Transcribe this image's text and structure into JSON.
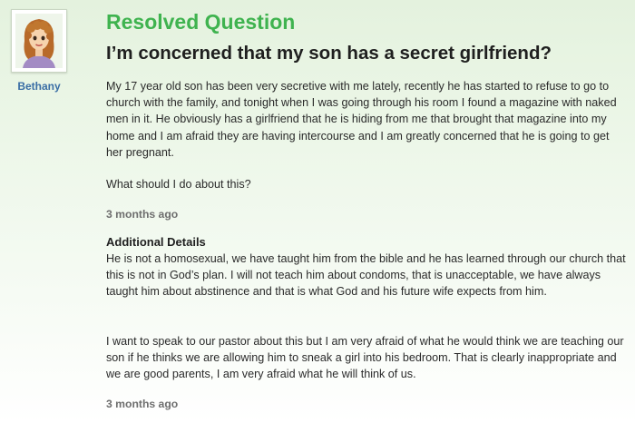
{
  "asker": {
    "name": "Bethany",
    "avatar_icon": "woman-avatar-icon"
  },
  "question": {
    "status": "Resolved Question",
    "title": "I’m concerned that my son has a secret girlfriend?",
    "body_p1": "My 17 year old son has been very secretive with me lately, recently he has started to refuse to go to church with the family, and tonight when I was going through his room I found a magazine with naked men in it. He obviously has a girlfriend that he is hiding from me that brought that magazine into my home and I am afraid they are having intercourse and I am greatly concerned that he is going to get her pregnant.",
    "body_p2": "What should I do about this?",
    "timestamp": "3 months ago"
  },
  "additional_details": {
    "heading": "Additional Details",
    "p1": "He is not a homosexual, we have taught him from the bible and he has learned through our church that this is not in God’s plan. I will not teach him about condoms, that is unacceptable, we have always taught him about abstinence and that is what God and his future wife expects from him.",
    "p2": "I want to speak to our pastor about this but I am very afraid of what he would think we are teaching our son if he thinks we are allowing him to sneak a girl into his bedroom. That is clearly inappropriate and we are good parents, I am very afraid what he will think of us.",
    "timestamp": "3 months ago"
  },
  "colors": {
    "status_green": "#3fb34f",
    "link_blue": "#3a6ea5",
    "meta_gray": "#6e6e6e"
  }
}
